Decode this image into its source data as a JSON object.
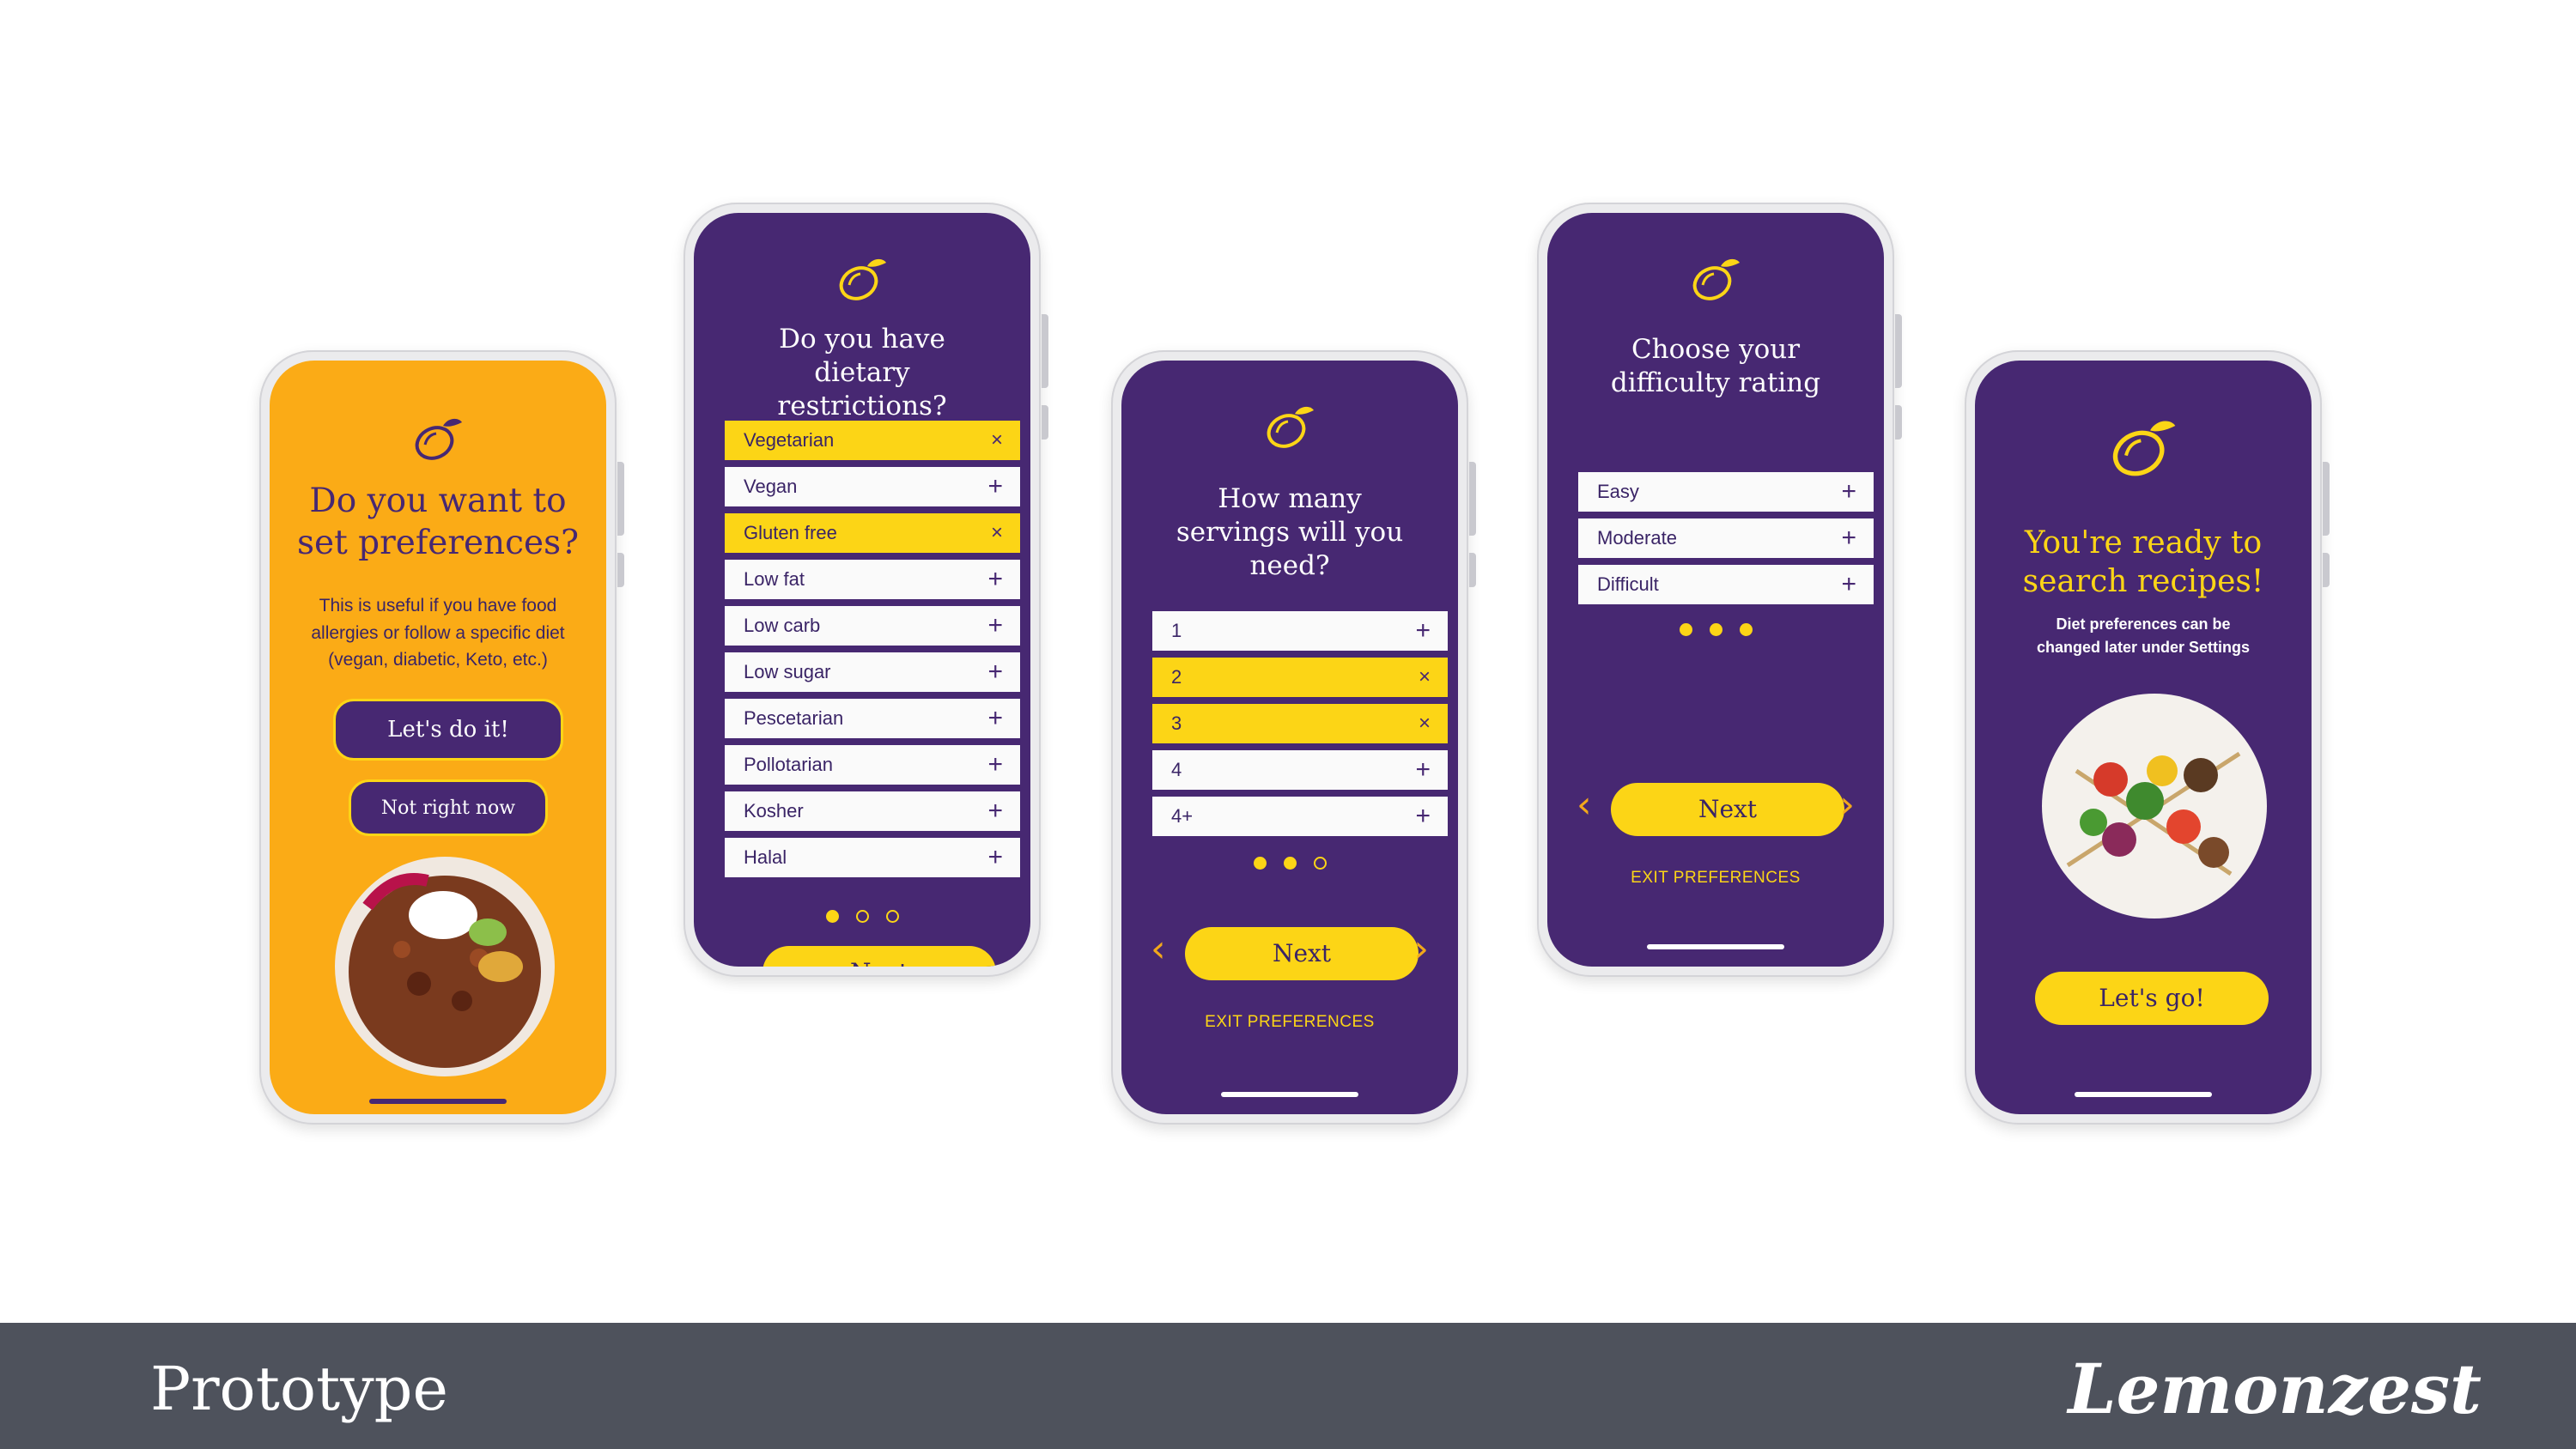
{
  "colors": {
    "purple": "#472872",
    "yellow": "#fcd516",
    "orange": "#fbab16",
    "footer": "#4e525c"
  },
  "screen1": {
    "title": "Do you want to set preferences?",
    "body": "This is useful if you have food allergies or follow a specific diet (vegan, diabetic, Keto, etc.)",
    "primary_button": "Let's do it!",
    "secondary_button": "Not right now"
  },
  "screen2": {
    "title": "Do you have dietary restrictions?",
    "options": [
      {
        "label": "Vegetarian",
        "selected": true
      },
      {
        "label": "Vegan",
        "selected": false
      },
      {
        "label": "Gluten free",
        "selected": true
      },
      {
        "label": "Low fat",
        "selected": false
      },
      {
        "label": "Low carb",
        "selected": false
      },
      {
        "label": "Low sugar",
        "selected": false
      },
      {
        "label": "Pescetarian",
        "selected": false
      },
      {
        "label": "Pollotarian",
        "selected": false
      },
      {
        "label": "Kosher",
        "selected": false
      },
      {
        "label": "Halal",
        "selected": false
      }
    ],
    "next_button": "Next",
    "progress_step": 1
  },
  "screen3": {
    "title": "How many servings will you need?",
    "options": [
      {
        "label": "1",
        "selected": false
      },
      {
        "label": "2",
        "selected": true
      },
      {
        "label": "3",
        "selected": true
      },
      {
        "label": "4",
        "selected": false
      },
      {
        "label": "4+",
        "selected": false
      }
    ],
    "next_button": "Next",
    "exit_link": "EXIT PREFERENCES",
    "progress_step": 2
  },
  "screen4": {
    "title": "Choose your difficulty rating",
    "options": [
      {
        "label": "Easy",
        "selected": false
      },
      {
        "label": "Moderate",
        "selected": false
      },
      {
        "label": "Difficult",
        "selected": false
      }
    ],
    "next_button": "Next",
    "exit_link": "EXIT PREFERENCES",
    "progress_step": 3
  },
  "screen5": {
    "title": "You're ready to search recipes!",
    "body": "Diet preferences can be changed later under Settings",
    "button": "Let's go!"
  },
  "icons": {
    "add": "+",
    "remove": "×",
    "prev": "‹",
    "next": "›"
  },
  "footer": {
    "title": "Prototype",
    "brand": "Lemonzest"
  }
}
